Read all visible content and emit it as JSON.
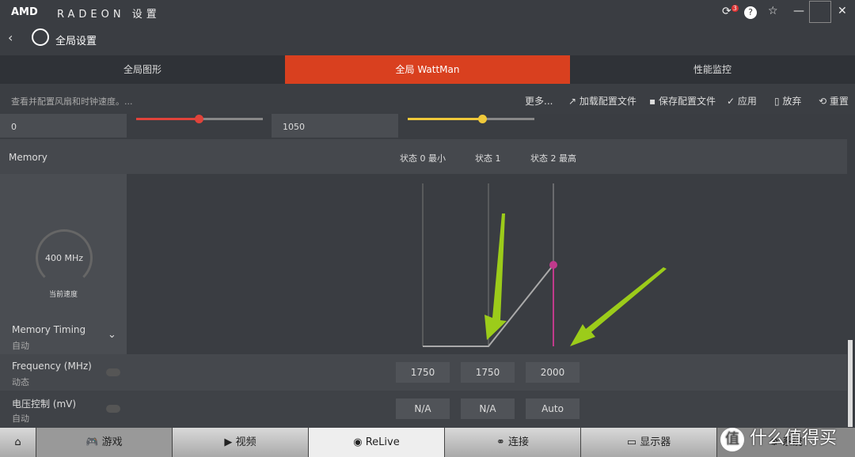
{
  "app": {
    "brand": "AMD",
    "title": "RADEON 设置",
    "notification_count": "3"
  },
  "header": {
    "title": "全局设置"
  },
  "tabs": [
    {
      "label": "全局图形"
    },
    {
      "label": "全局 WattMan",
      "active": true
    },
    {
      "label": "性能监控"
    }
  ],
  "toolbar": {
    "description": "查看并配置风扇和时钟速度。...",
    "more": "更多...",
    "load": "加载配置文件",
    "save": "保存配置文件",
    "apply": "应用",
    "discard": "放弃",
    "reset": "重置"
  },
  "top_row": {
    "left_value": "0",
    "left_slider_percent": 50,
    "right_value": "1050",
    "right_slider_percent": 60
  },
  "memory": {
    "label": "Memory",
    "gauge_value": "400 MHz",
    "gauge_label": "当前速度",
    "states": [
      "状态 0 最小",
      "状态 1",
      "状态 2 最高"
    ],
    "frequencies": [
      "1750",
      "1750",
      "2000"
    ],
    "voltages": [
      "N/A",
      "N/A",
      "Auto"
    ],
    "timing": {
      "label": "Memory Timing",
      "value": "自动"
    },
    "frequency": {
      "label": "Frequency (MHz)",
      "value": "动态"
    },
    "voltage": {
      "label": "电压控制 (mV)",
      "value": "自动"
    }
  },
  "colors": {
    "accent": "#d9401f",
    "curve_point": "#c03a8c",
    "slider_red": "#e0433a",
    "slider_yellow": "#f0c93a",
    "arrow": "#9ccc1a"
  },
  "bottom_nav": [
    {
      "label": "游戏"
    },
    {
      "label": "视频"
    },
    {
      "label": "ReLive"
    },
    {
      "label": "连接"
    },
    {
      "label": "显示器"
    },
    {
      "label": "系统"
    }
  ],
  "watermark": "什么值得买"
}
